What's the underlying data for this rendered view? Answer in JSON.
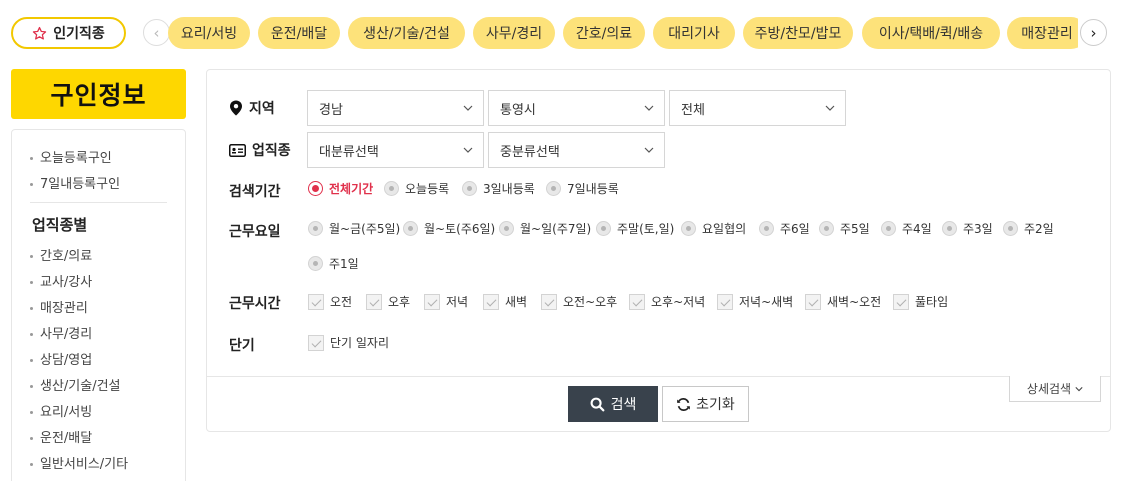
{
  "topbar": {
    "popular_label": "인기직종",
    "prev_icon": "chevron-left-icon",
    "next_icon": "chevron-right-icon",
    "chips": [
      "요리/서빙",
      "운전/배달",
      "생산/기술/건설",
      "사무/경리",
      "간호/의료",
      "대리기사",
      "주방/찬모/밥모",
      "이사/택배/퀵/배송",
      "매장관리"
    ],
    "chip_color": "#fde27a",
    "accent": "#fed700"
  },
  "sidebar": {
    "title": "구인정보",
    "recent": [
      "오늘등록구인",
      "7일내등록구인"
    ],
    "heading": "업직종별",
    "categories": [
      "간호/의료",
      "교사/강사",
      "매장관리",
      "사무/경리",
      "상담/영업",
      "생산/기술/건설",
      "요리/서빙",
      "운전/배달",
      "일반서비스/기타"
    ]
  },
  "search": {
    "region": {
      "label": "지역",
      "icon": "map-pin-icon",
      "selects": [
        "경남",
        "통영시",
        "전체"
      ]
    },
    "job_type": {
      "label": "업직종",
      "icon": "id-card-icon",
      "selects": [
        "대분류선택",
        "중분류선택"
      ]
    },
    "period": {
      "label": "검색기간",
      "options": [
        "전체기간",
        "오늘등록",
        "3일내등록",
        "7일내등록"
      ],
      "selected": "전체기간"
    },
    "workdays": {
      "label": "근무요일",
      "options": [
        "월~금(주5일)",
        "월~토(주6일)",
        "월~일(주7일)",
        "주말(토,일)",
        "요일협의",
        "주6일",
        "주5일",
        "주4일",
        "주3일",
        "주2일",
        "주1일"
      ]
    },
    "worktime": {
      "label": "근무시간",
      "options": [
        "오전",
        "오후",
        "저녁",
        "새벽",
        "오전~오후",
        "오후~저녁",
        "저녁~새벽",
        "새벽~오전",
        "풀타임"
      ]
    },
    "shortterm": {
      "label": "단기",
      "options": [
        "단기 일자리"
      ]
    },
    "buttons": {
      "search": "검색",
      "reset": "초기화",
      "detail": "상세검색"
    },
    "selected_color": "#e0304b",
    "search_button_color": "#39424c"
  }
}
